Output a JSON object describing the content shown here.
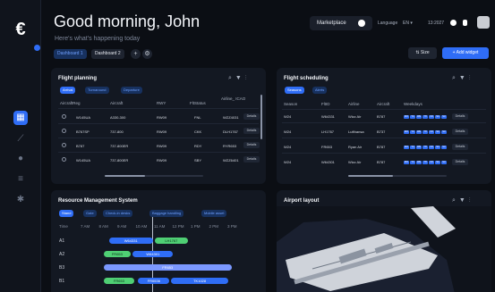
{
  "app": {
    "logo": "€"
  },
  "header": {
    "title": "Good morning, John",
    "subtitle": "Here's what's happening today",
    "marketplace": "Marketplace",
    "language_label": "Language",
    "language_value": "EN ▾",
    "time": "13:2027"
  },
  "dashboard_tabs": [
    "Dashboard 1",
    "Dashboard 2"
  ],
  "actions": {
    "size": "⇅ Size",
    "add_widget": "+ Add widget"
  },
  "flight_planning": {
    "title": "Flight planning",
    "chips": [
      "Arrival",
      "Turnaround",
      "Departure"
    ],
    "columns": [
      "AircraftReg",
      "Aircraft",
      "RWY",
      "FltStatus",
      "Airline_ ICAO"
    ],
    "rows": [
      {
        "reg": "W145UA",
        "aircraft": "A330-300",
        "rwy": "RW09",
        "status": "FNL",
        "icao": "WZZ4031"
      },
      {
        "reg": "B767SP",
        "aircraft": "737-800",
        "rwy": "RW09",
        "status": "CKK",
        "icao": "DLH1767"
      },
      {
        "reg": "B787",
        "aircraft": "737-800ER",
        "rwy": "RW09",
        "status": "RDY",
        "icao": "RYR653"
      },
      {
        "reg": "W145UA",
        "aircraft": "737-800ER",
        "rwy": "RW09",
        "status": "SBY",
        "icao": "WZZ6401"
      }
    ],
    "details": "Details"
  },
  "flight_scheduling": {
    "title": "Flight scheduling",
    "chips": [
      "Seasons",
      "Alerts"
    ],
    "columns": [
      "Season",
      "FltID",
      "Airline",
      "Aircraft",
      "Weekdays"
    ],
    "rows": [
      {
        "season": "W24",
        "fltid": "W64331",
        "airline": "Wizz Air",
        "aircraft": "B787"
      },
      {
        "season": "W24",
        "fltid": "LH1767",
        "airline": "Lufthansa",
        "aircraft": "B737"
      },
      {
        "season": "W24",
        "fltid": "FR653",
        "airline": "Ryan Air",
        "aircraft": "B787"
      },
      {
        "season": "W24",
        "fltid": "W64301",
        "airline": "Wizz Air",
        "aircraft": "B787"
      }
    ],
    "weekdays": [
      "MO",
      "TU",
      "WE",
      "TH",
      "FR",
      "SA",
      "SU"
    ],
    "details": "Details"
  },
  "resource": {
    "title": "Resource Management System",
    "chips": [
      "Stand",
      "Gate",
      "Check-in desks",
      "Baggage handling",
      "Mobile asset"
    ],
    "time_label": "Time",
    "times": [
      "7 AM",
      "8 AM",
      "9 AM",
      "10 AM",
      "11 AM",
      "12 PM",
      "1 PM",
      "2 PM",
      "3 PM"
    ],
    "lanes": [
      "A1",
      "A2",
      "B3",
      "B1"
    ],
    "bars": [
      {
        "label": "W64331",
        "lane": 0,
        "start": 8.3,
        "end": 10.7,
        "color": "b"
      },
      {
        "label": "LH1767",
        "lane": 0,
        "start": 10.8,
        "end": 12.6,
        "color": "g"
      },
      {
        "label": "FR653",
        "lane": 1,
        "start": 8.0,
        "end": 9.5,
        "color": "g"
      },
      {
        "label": "W64301",
        "lane": 1,
        "start": 9.6,
        "end": 11.8,
        "color": "b"
      },
      {
        "label": "FR653",
        "lane": 2,
        "start": 8.0,
        "end": 15.0,
        "color": "l"
      },
      {
        "label": "FR653",
        "lane": 3,
        "start": 8.0,
        "end": 9.7,
        "color": "g"
      },
      {
        "label": "FR6536",
        "lane": 3,
        "start": 9.9,
        "end": 11.6,
        "color": "b"
      },
      {
        "label": "TK1028",
        "lane": 3,
        "start": 11.7,
        "end": 14.8,
        "color": "b"
      }
    ]
  },
  "airport": {
    "title": "Airport layout"
  },
  "colors": {
    "accent": "#2f6df6",
    "green": "#4fcf74",
    "panel": "#131822",
    "bg": "#0b0e14"
  }
}
